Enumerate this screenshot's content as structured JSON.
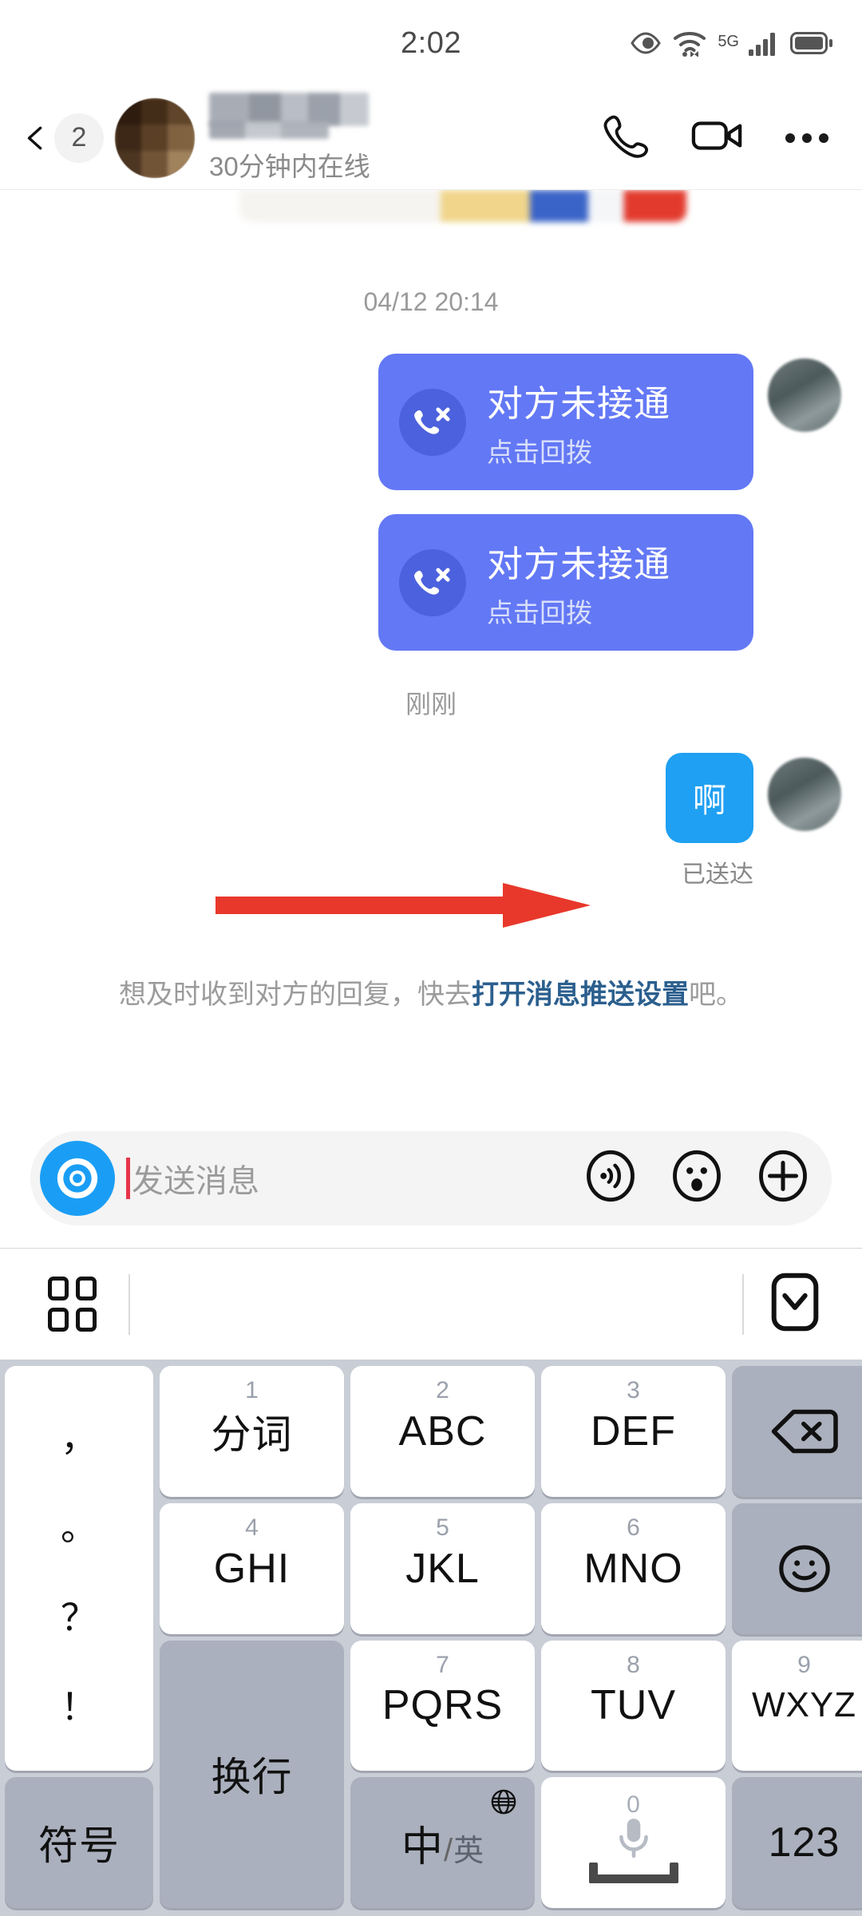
{
  "statusbar": {
    "time": "2:02",
    "network": "5G",
    "icons": [
      "eye-icon",
      "wifi-icon",
      "signal-icon",
      "battery-icon"
    ]
  },
  "header": {
    "back_badge": "2",
    "contact_name": "",
    "online_status": "30分钟内在线",
    "actions": [
      "phone-call-icon",
      "video-call-icon",
      "more-options-icon"
    ]
  },
  "chat": {
    "timestamp_top": "04/12 20:14",
    "timestamp_recent": "刚刚",
    "call_messages": [
      {
        "title": "对方未接通",
        "subtitle": "点击回拨"
      },
      {
        "title": "对方未接通",
        "subtitle": "点击回拨"
      }
    ],
    "text_message": "啊",
    "delivery_status": "已送达"
  },
  "hint": {
    "prefix": "想及时收到对方的回复，快去",
    "link": "打开消息推送设置",
    "suffix": "吧。"
  },
  "input_bar": {
    "placeholder": "发送消息",
    "camera_icon": "camera-shutter-icon",
    "icons": [
      "voice-input-icon",
      "emoji-icon",
      "add-more-icon"
    ]
  },
  "keyboard_toolbar": {
    "grid_icon": "app-grid-icon",
    "collapse_icon": "collapse-keyboard-icon"
  },
  "keyboard": {
    "punctuation": [
      "，",
      "。",
      "？",
      "！"
    ],
    "keys": [
      {
        "num": "1",
        "label": "分词",
        "type": "cjk"
      },
      {
        "num": "2",
        "label": "ABC",
        "type": "latin"
      },
      {
        "num": "3",
        "label": "DEF",
        "type": "latin"
      },
      {
        "num": "4",
        "label": "GHI",
        "type": "latin"
      },
      {
        "num": "5",
        "label": "JKL",
        "type": "latin"
      },
      {
        "num": "6",
        "label": "MNO",
        "type": "latin"
      },
      {
        "num": "7",
        "label": "PQRS",
        "type": "latin"
      },
      {
        "num": "8",
        "label": "TUV",
        "type": "latin"
      },
      {
        "num": "9",
        "label": "WXYZ",
        "type": "latin"
      }
    ],
    "backspace": "backspace-icon",
    "emoji": "emoji-face-icon",
    "enter_label": "换行",
    "symbol_label": "符号",
    "lang_cn": "中",
    "lang_slash": "/",
    "lang_en": "英",
    "space_num": "0",
    "numeric_label": "123"
  },
  "colors": {
    "call_bubble": "#6378f5",
    "call_icon_circle": "#4c61dd",
    "text_bubble": "#1fa0f2",
    "link": "#2b5f8e",
    "annotation_arrow": "#e8382b",
    "keyboard_bg": "#c9cdd6",
    "key_grey": "#aab0bd"
  }
}
